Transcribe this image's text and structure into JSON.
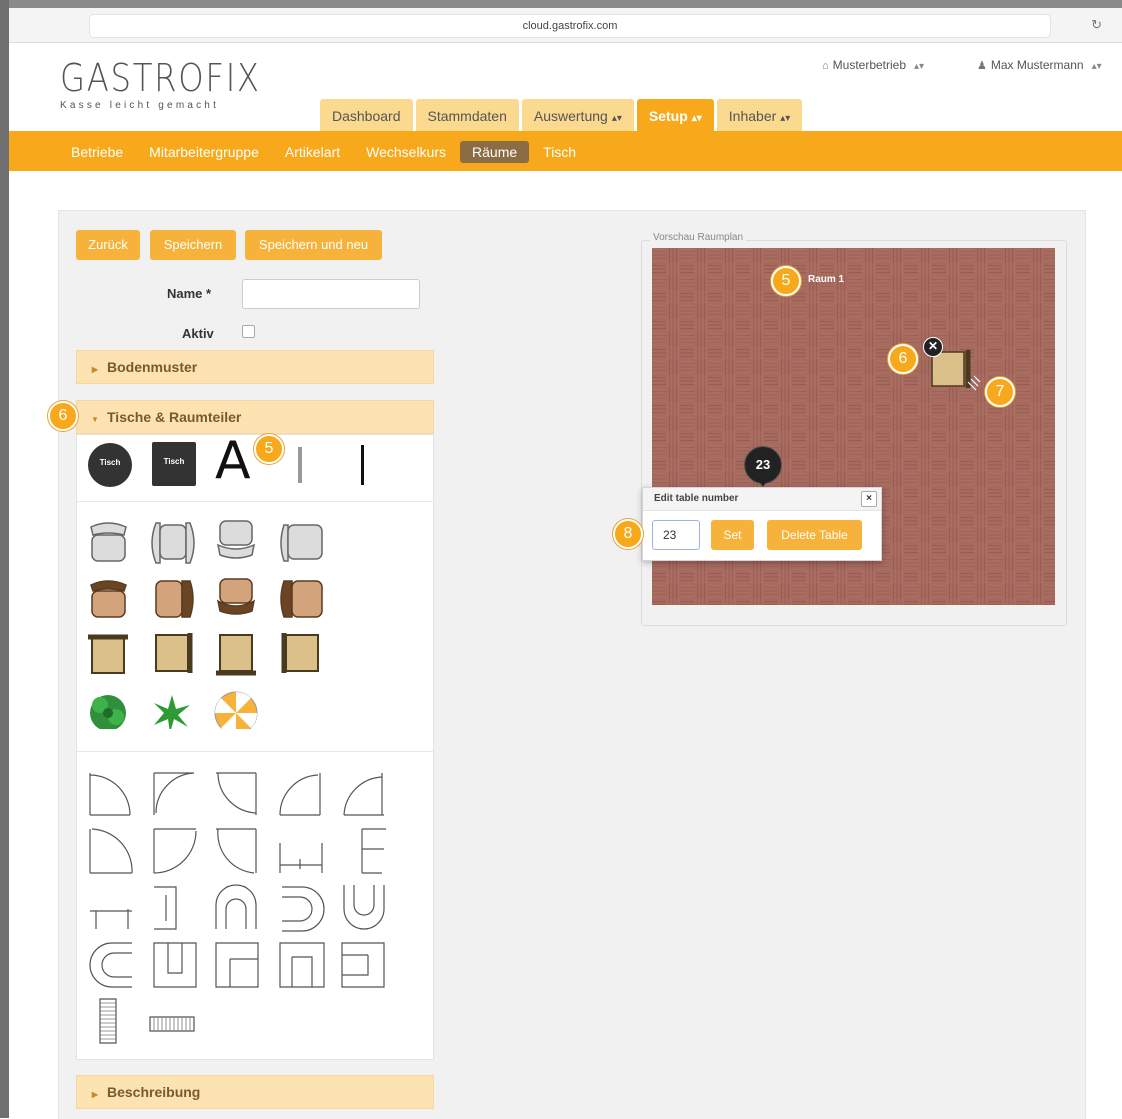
{
  "browser": {
    "url": "cloud.gastrofix.com"
  },
  "logo": {
    "name": "GASTROFIX",
    "tagline": "Kasse leicht gemacht"
  },
  "header": {
    "business": "Musterbetrieb",
    "user": "Max Mustermann",
    "caret": "▴▾"
  },
  "main_tabs": [
    {
      "label": "Dashboard",
      "caret": ""
    },
    {
      "label": "Stammdaten",
      "caret": ""
    },
    {
      "label": "Auswertung",
      "caret": "▴▾"
    },
    {
      "label": "Setup",
      "caret": "▴▾"
    },
    {
      "label": "Inhaber",
      "caret": "▴▾"
    }
  ],
  "active_main_tab": "Setup",
  "sub_nav": [
    "Betriebe",
    "Mitarbeitergruppe",
    "Artikelart",
    "Wechselkurs",
    "Räume",
    "Tisch"
  ],
  "active_sub_nav": "Räume",
  "form": {
    "buttons": {
      "back": "Zurück",
      "save": "Speichern",
      "save_new": "Speichern und neu"
    },
    "name_label": "Name *",
    "name_value": "",
    "active_label": "Aktiv",
    "active_checked": false
  },
  "sections": {
    "floor_pattern": "Bodenmuster",
    "tables_dividers": "Tische & Raumteiler",
    "description": "Beschreibung"
  },
  "palette": {
    "round_table_label": "Tisch",
    "square_table_label": "Tisch",
    "text_tool": "A",
    "chairs": [
      "grey",
      "brown",
      "wood"
    ],
    "plants": [
      "plant-green",
      "plant-palm",
      "umbrella"
    ]
  },
  "preview": {
    "legend": "Vorschau Raumplan",
    "room_name": "Raum 1",
    "table_number": "23"
  },
  "popover": {
    "title": "Edit table number",
    "close": "×",
    "value": "23",
    "set": "Set",
    "delete": "Delete Table"
  },
  "callouts": {
    "five": "5",
    "six": "6",
    "seven": "7",
    "eight": "8"
  },
  "colors": {
    "accent": "#f7a81b",
    "accent_light": "#fde3b1",
    "active_subnav": "#8c6c42",
    "floor": "#a66a5f"
  }
}
